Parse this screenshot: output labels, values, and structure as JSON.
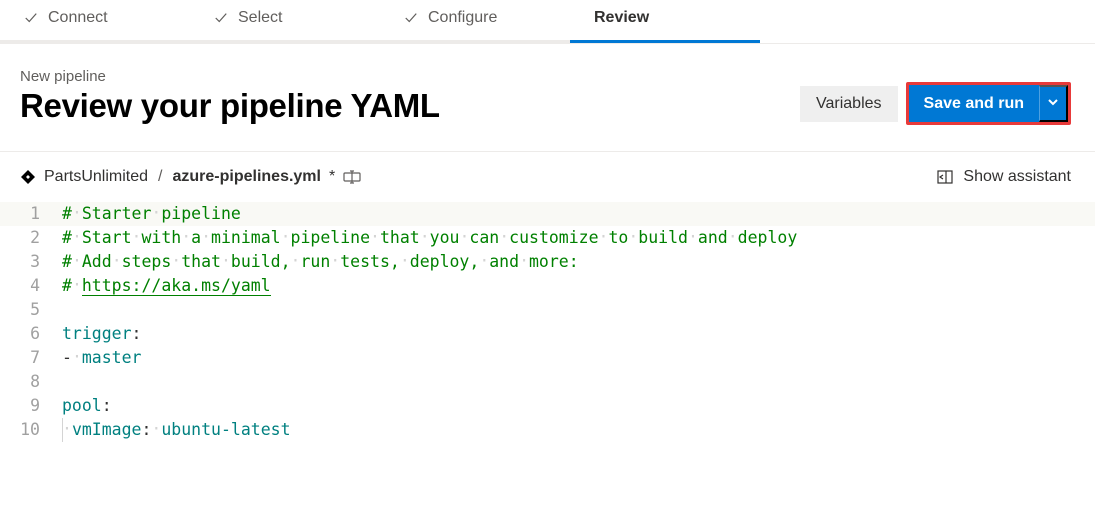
{
  "stepper": {
    "steps": [
      {
        "label": "Connect",
        "done": true,
        "active": false
      },
      {
        "label": "Select",
        "done": true,
        "active": false
      },
      {
        "label": "Configure",
        "done": true,
        "active": false
      },
      {
        "label": "Review",
        "done": false,
        "active": true
      }
    ]
  },
  "header": {
    "breadcrumb": "New pipeline",
    "title": "Review your pipeline YAML",
    "variables_label": "Variables",
    "save_run_label": "Save and run"
  },
  "filebar": {
    "repo_name": "PartsUnlimited",
    "slash": "/",
    "file_name": "azure-pipelines.yml",
    "dirty_marker": "*",
    "show_assistant_label": "Show assistant"
  },
  "editor": {
    "lines": [
      {
        "n": 1,
        "type": "comment",
        "parts": [
          "#",
          "Starter",
          "pipeline"
        ]
      },
      {
        "n": 2,
        "type": "comment",
        "parts": [
          "#",
          "Start",
          "with",
          "a",
          "minimal",
          "pipeline",
          "that",
          "you",
          "can",
          "customize",
          "to",
          "build",
          "and",
          "deploy"
        ]
      },
      {
        "n": 3,
        "type": "comment",
        "parts": [
          "#",
          "Add",
          "steps",
          "that",
          "build,",
          "run",
          "tests,",
          "deploy,",
          "and",
          "more:"
        ]
      },
      {
        "n": 4,
        "type": "comment-url",
        "prefix": "#",
        "url": "https://aka.ms/yaml"
      },
      {
        "n": 5,
        "type": "blank"
      },
      {
        "n": 6,
        "type": "key",
        "key": "trigger",
        "colon": ":"
      },
      {
        "n": 7,
        "type": "list-item",
        "dash": "-",
        "value": "master"
      },
      {
        "n": 8,
        "type": "blank"
      },
      {
        "n": 9,
        "type": "key",
        "key": "pool",
        "colon": ":"
      },
      {
        "n": 10,
        "type": "child-kv",
        "key": "vmImage",
        "colon": ":",
        "value": "ubuntu-latest"
      }
    ]
  }
}
